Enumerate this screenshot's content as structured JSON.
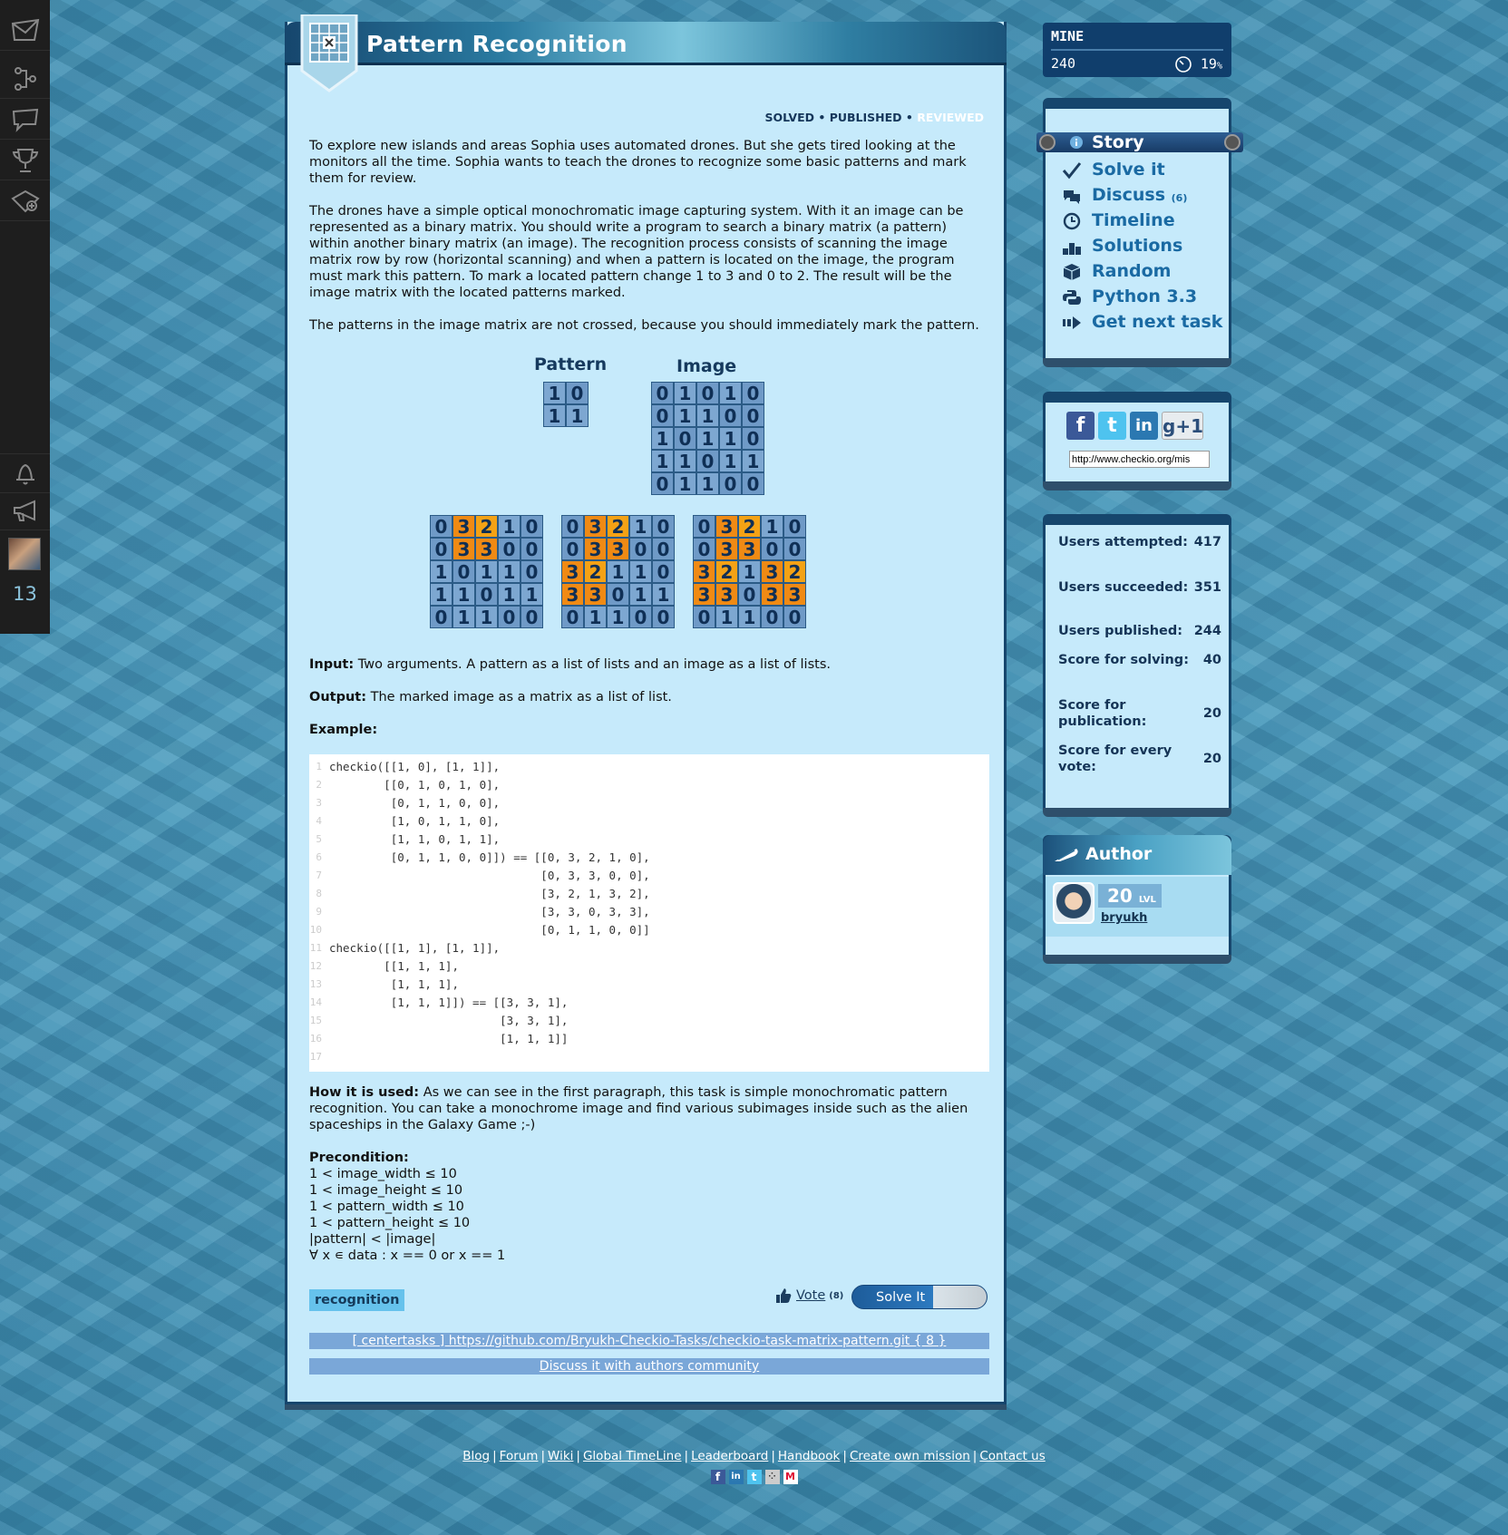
{
  "sidebar": {
    "count": "13",
    "icons": [
      "envelope-icon",
      "tree-icon",
      "chat-icon",
      "trophy-icon",
      "map-add-icon",
      "bell-icon",
      "megaphone-icon"
    ]
  },
  "mission": {
    "title": "Pattern Recognition",
    "status_solved": "SOLVED",
    "status_published": "PUBLISHED",
    "status_reviewed": "REVIEWED",
    "sep": "•"
  },
  "text": {
    "p1": "To explore new islands and areas Sophia uses automated drones. But she gets tired looking at the monitors all the time. Sophia wants to teach the drones to recognize some basic patterns and mark them for review.",
    "p2": "The drones have a simple optical monochromatic image capturing system. With it an image can be represented as a binary matrix. You should write a program to search a binary matrix (a pattern) within another binary matrix (an image). The recognition process consists of scanning the image matrix row by row (horizontal scanning) and when a pattern is located on the image, the program must mark this pattern. To mark a located pattern change 1 to 3 and 0 to 2. The result will be the image matrix with the located patterns marked.",
    "p3": "The patterns in the image matrix are not crossed, because you should immediately mark the pattern.",
    "input_label": "Input:",
    "input": " Two arguments. A pattern as a list of lists and an image as a list of lists.",
    "output_label": "Output:",
    "output": " The marked image as a matrix as a list of list.",
    "example_label": "Example:",
    "how_label": "How it is used:",
    "how": " As we can see in the first paragraph, this task is simple monochromatic pattern recognition. You can take a monochrome image and find various subimages inside such as the alien spaceships in the Galaxy Game ;-)",
    "pre_label": "Precondition:",
    "pre": [
      "1 < image_width ≤ 10",
      "1 < image_height ≤ 10",
      "1 < pattern_width ≤ 10",
      "1 < pattern_height ≤ 10",
      "|pattern| < |image|",
      "∀ x ∊ data : x == 0 or x == 1"
    ]
  },
  "matrices": {
    "pattern_label": "Pattern",
    "image_label": "Image",
    "pattern": [
      [
        1,
        0
      ],
      [
        1,
        1
      ]
    ],
    "image": [
      [
        0,
        1,
        0,
        1,
        0
      ],
      [
        0,
        1,
        1,
        0,
        0
      ],
      [
        1,
        0,
        1,
        1,
        0
      ],
      [
        1,
        1,
        0,
        1,
        1
      ],
      [
        0,
        1,
        1,
        0,
        0
      ]
    ],
    "steps": [
      [
        [
          0,
          3,
          2,
          1,
          0
        ],
        [
          0,
          3,
          3,
          0,
          0
        ],
        [
          1,
          0,
          1,
          1,
          0
        ],
        [
          1,
          1,
          0,
          1,
          1
        ],
        [
          0,
          1,
          1,
          0,
          0
        ]
      ],
      [
        [
          0,
          3,
          2,
          1,
          0
        ],
        [
          0,
          3,
          3,
          0,
          0
        ],
        [
          3,
          2,
          1,
          1,
          0
        ],
        [
          3,
          3,
          0,
          1,
          1
        ],
        [
          0,
          1,
          1,
          0,
          0
        ]
      ],
      [
        [
          0,
          3,
          2,
          1,
          0
        ],
        [
          0,
          3,
          3,
          0,
          0
        ],
        [
          3,
          2,
          1,
          3,
          2
        ],
        [
          3,
          3,
          0,
          3,
          3
        ],
        [
          0,
          1,
          1,
          0,
          0
        ]
      ]
    ],
    "highlight": [
      [
        [
          0,
          1,
          1,
          0,
          0
        ],
        [
          0,
          1,
          1,
          0,
          0
        ],
        [
          0,
          0,
          0,
          0,
          0
        ],
        [
          0,
          0,
          0,
          0,
          0
        ],
        [
          0,
          0,
          0,
          0,
          0
        ]
      ],
      [
        [
          0,
          1,
          1,
          0,
          0
        ],
        [
          0,
          1,
          1,
          0,
          0
        ],
        [
          1,
          1,
          0,
          0,
          0
        ],
        [
          1,
          1,
          0,
          0,
          0
        ],
        [
          0,
          0,
          0,
          0,
          0
        ]
      ],
      [
        [
          0,
          1,
          1,
          0,
          0
        ],
        [
          0,
          1,
          1,
          0,
          0
        ],
        [
          1,
          1,
          0,
          1,
          1
        ],
        [
          1,
          1,
          0,
          1,
          1
        ],
        [
          0,
          0,
          0,
          0,
          0
        ]
      ]
    ]
  },
  "code": [
    "checkio([[1, 0], [1, 1]],",
    "        [[0, 1, 0, 1, 0],",
    "         [0, 1, 1, 0, 0],",
    "         [1, 0, 1, 1, 0],",
    "         [1, 1, 0, 1, 1],",
    "         [0, 1, 1, 0, 0]]) == [[0, 3, 2, 1, 0],",
    "                               [0, 3, 3, 0, 0],",
    "                               [3, 2, 1, 3, 2],",
    "                               [3, 3, 0, 3, 3],",
    "                               [0, 1, 1, 0, 0]]",
    "checkio([[1, 1], [1, 1]],",
    "        [[1, 1, 1],",
    "         [1, 1, 1],",
    "         [1, 1, 1]]) == [[3, 3, 1],",
    "                         [3, 3, 1],",
    "                         [1, 1, 1]]",
    ""
  ],
  "actions": {
    "tag": "recognition",
    "vote": "Vote",
    "vote_count": "(8)",
    "solve": "Solve It",
    "repo": "[ centertasks ] https://github.com/Bryukh-Checkio-Tasks/checkio-task-matrix-pattern.git { 8 }",
    "discuss": "Discuss it with authors community"
  },
  "mine": {
    "label": "MINE",
    "points": "240",
    "percent": "19",
    "percent_sign": "%"
  },
  "nav": {
    "story": "Story",
    "solve": "Solve it",
    "discuss": "Discuss",
    "discuss_count": "(6)",
    "timeline": "Timeline",
    "solutions": "Solutions",
    "random": "Random",
    "python": "Python 3.3",
    "next": "Get next task"
  },
  "share": {
    "url": "http://www.checkio.org/mis",
    "gplus": "+1"
  },
  "stats": [
    {
      "label": "Users attempted:",
      "value": "417"
    },
    {
      "label": "Users succeeded:",
      "value": "351"
    },
    {
      "label": "Users published:",
      "value": "244"
    },
    {
      "label": "Score for solving:",
      "value": "40"
    },
    {
      "label": "Score for publication:",
      "value": "20"
    },
    {
      "label": "Score for every vote:",
      "value": "20"
    }
  ],
  "author": {
    "title": "Author",
    "level": "20",
    "lvl": "LVL",
    "name": "bryukh"
  },
  "footer": {
    "links": [
      "Blog",
      "Forum",
      "Wiki",
      "Global TimeLine",
      "Leaderboard",
      "Handbook",
      "Create own mission",
      "Contact us"
    ]
  },
  "colors": {
    "panel": "#c6eafb",
    "dark": "#16466d",
    "orange": "#f08a14",
    "cell": "#7da7d1"
  }
}
